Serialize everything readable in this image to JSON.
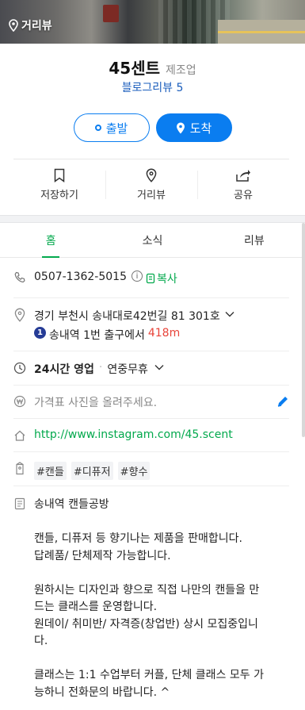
{
  "header": {
    "streetview_label": "거리뷰",
    "place_name": "45센트",
    "category": "제조업",
    "blog_review": "블로그리뷰 5"
  },
  "route_buttons": {
    "depart": "출발",
    "arrive": "도착"
  },
  "actions": [
    {
      "label": "저장하기",
      "icon": "bookmark-icon"
    },
    {
      "label": "거리뷰",
      "icon": "location-pin-icon"
    },
    {
      "label": "공유",
      "icon": "share-icon"
    }
  ],
  "tabs": [
    {
      "label": "홈",
      "active": true
    },
    {
      "label": "소식",
      "active": false
    },
    {
      "label": "리뷰",
      "active": false
    }
  ],
  "info": {
    "phone": "0507-1362-5015",
    "phone_info_icon": "i",
    "copy_label": "복사",
    "address": "경기 부천시 송내대로42번길 81 301호",
    "subway_line": "1",
    "subway_text": "송내역 1번 출구에서",
    "subway_distance": "418m",
    "hours_main": "24시간 영업",
    "hours_sub": "연중무휴",
    "price_placeholder": "가격표 사진을 올려주세요.",
    "website": "http://www.instagram.com/45.scent",
    "tags": [
      "#캔들",
      "#디퓨저",
      "#향수"
    ]
  },
  "description": {
    "title": "송내역 캔들공방",
    "lines": [
      "",
      "캔들, 디퓨저 등 향기나는 제품을 판매합니다.",
      "답례품/ 단체제작 가능합니다.",
      "",
      "원하시는 디자인과 향으로 직접 나만의 캔들을 만",
      "드는 클래스를 운영합니다.",
      "원데이/ 취미반/ 자격증(창업반) 상시 모집중입니",
      "다.",
      "",
      "클래스는 1:1 수업부터 커플, 단체 클래스 모두 가",
      "능하니 전화문의 바랍니다. ^"
    ]
  },
  "colors": {
    "accent_blue": "#0a7df0",
    "accent_green": "#03a94d",
    "link_blue": "#1a5dbc",
    "distance_red": "#e8443a",
    "subway_line1": "#263c96"
  }
}
